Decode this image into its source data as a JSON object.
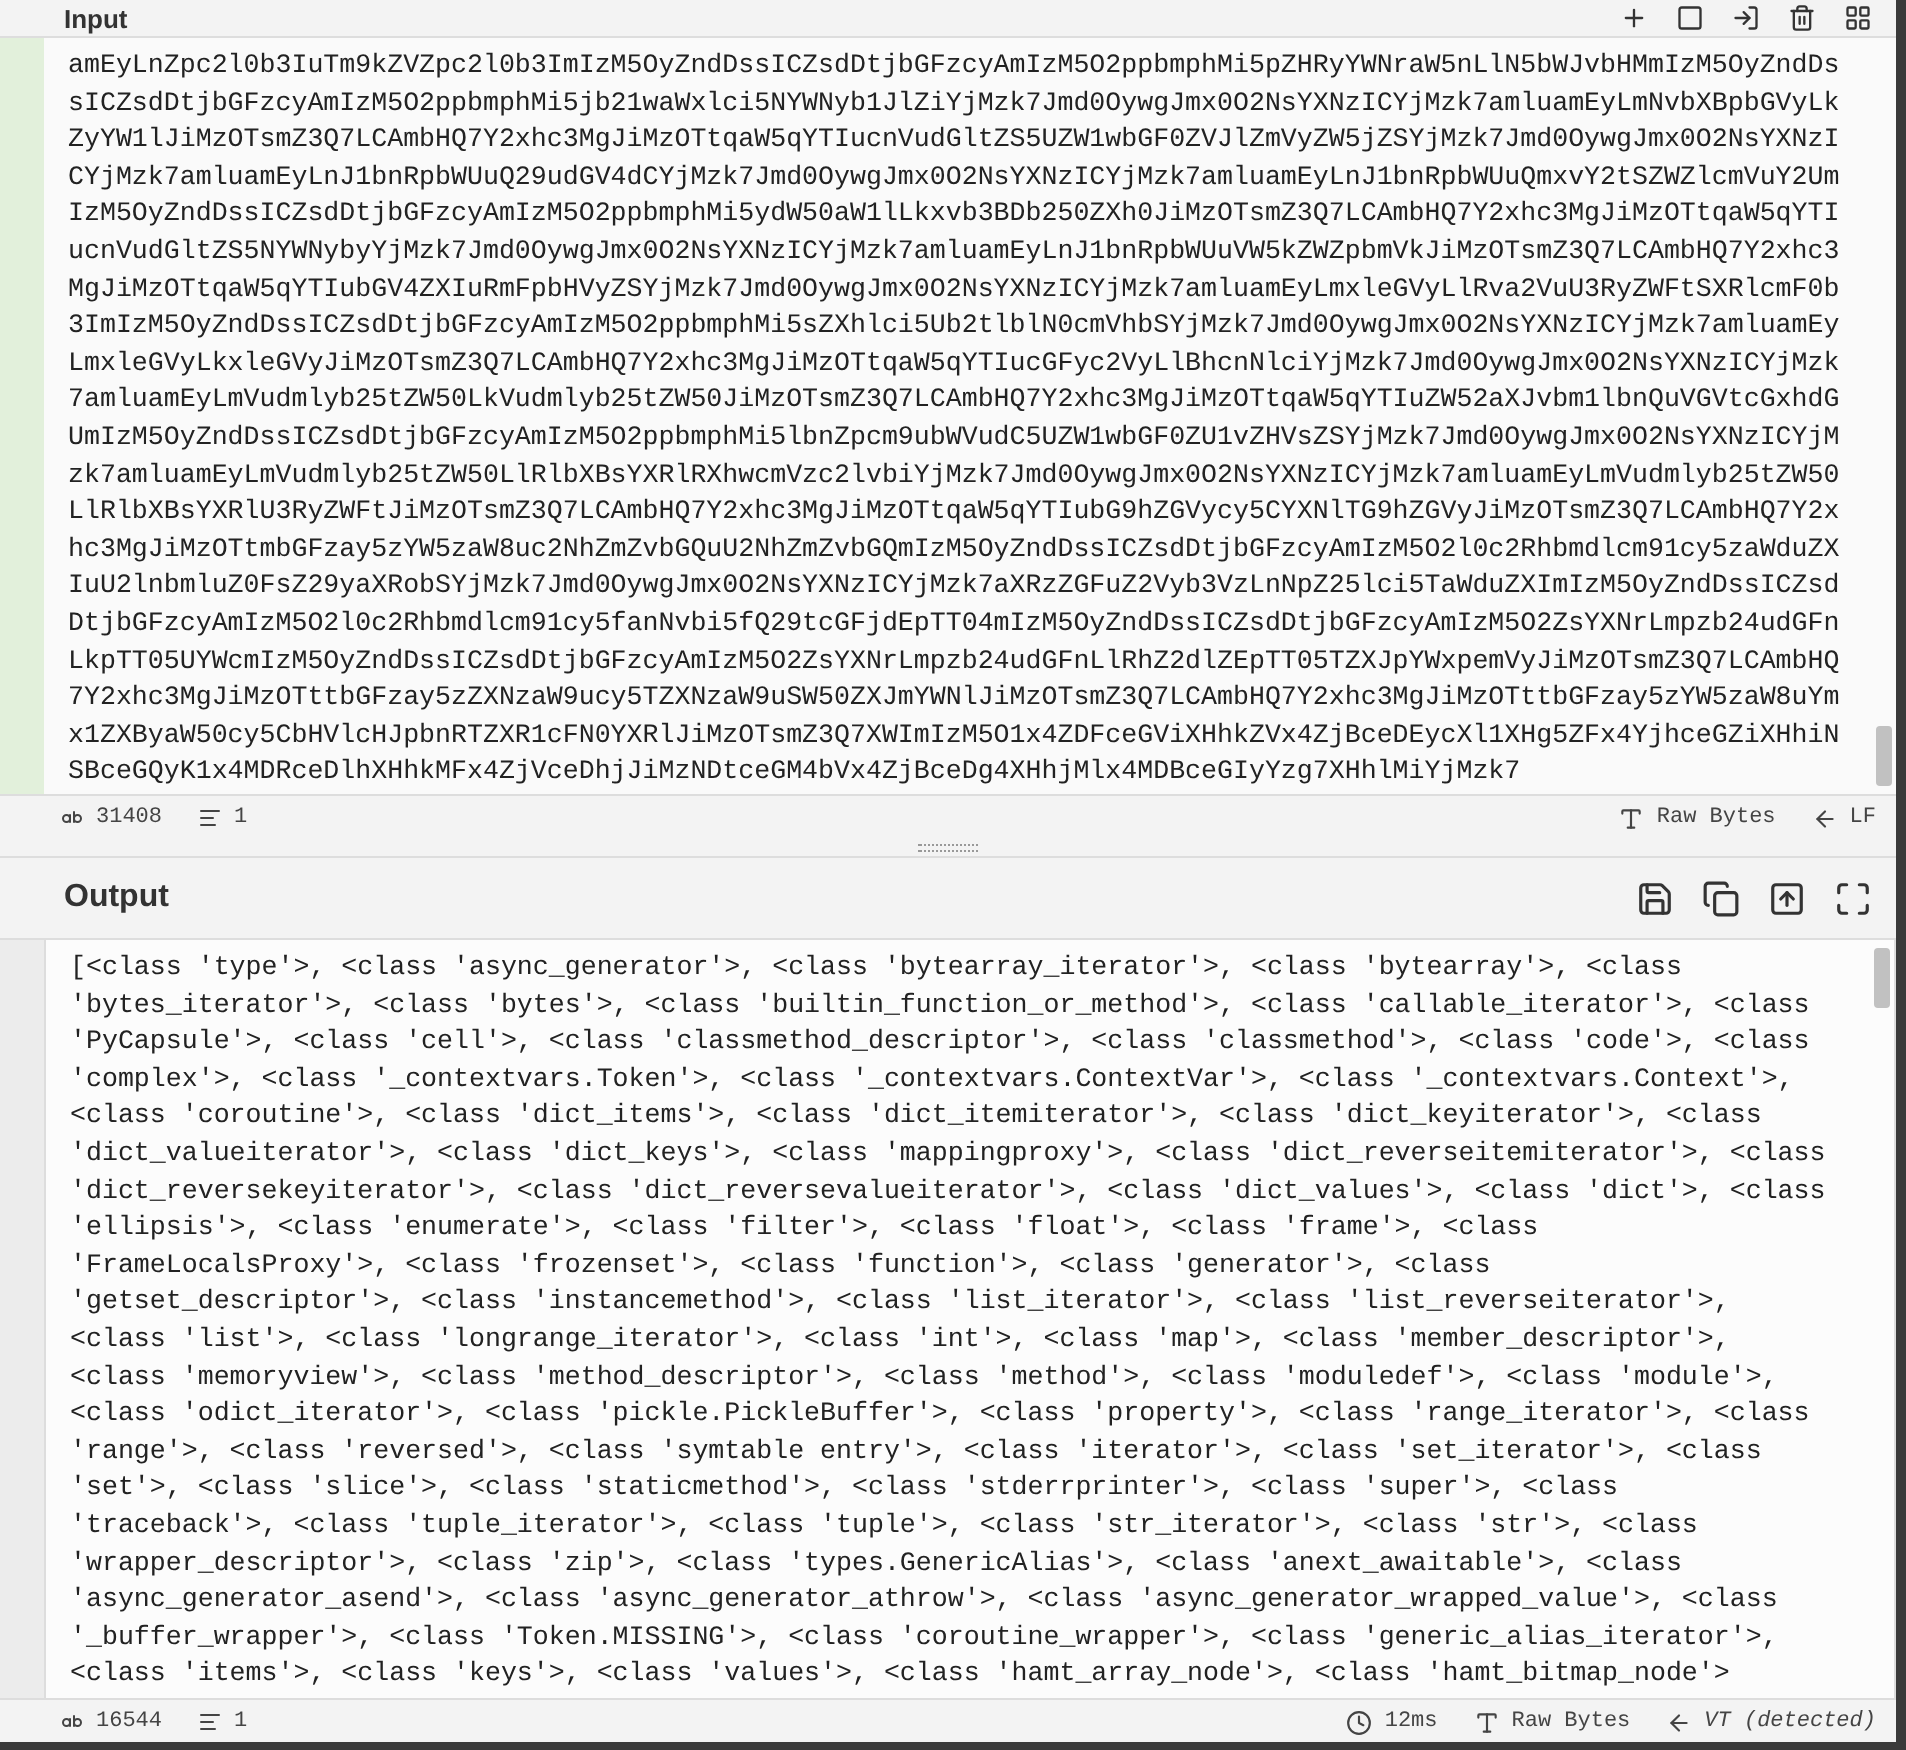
{
  "input": {
    "title": "Input",
    "lines": [
      "amEyLnZpc2l0b3IuTm9kZVZpc2l0b3ImIzM5OyZndDssICZsdDtjbGFzcyAmIzM5O2ppbmphMi5pZHRyYWNraW5nLlN5bWJvbHMmIzM5OyZndDs",
      "sICZsdDtjbGFzcyAmIzM5O2ppbmphMi5jb21waWxlci5NYWNyb1JlZiYjMzk7Jmd0OywgJmx0O2NsYXNzICYjMzk7amluamEyLmNvbXBpbGVyLk",
      "ZyYW1lJiMzOTsmZ3Q7LCAmbHQ7Y2xhc3MgJiMzOTtqaW5qYTIucnVudGltZS5UZW1wbGF0ZVJlZmVyZW5jZSYjMzk7Jmd0OywgJmx0O2NsYXNzI",
      "CYjMzk7amluamEyLnJ1bnRpbWUuQ29udGV4dCYjMzk7Jmd0OywgJmx0O2NsYXNzICYjMzk7amluamEyLnJ1bnRpbWUuQmxvY2tSZWZlcmVuY2Um",
      "IzM5OyZndDssICZsdDtjbGFzcyAmIzM5O2ppbmphMi5ydW50aW1lLkxvb3BDb250ZXh0JiMzOTsmZ3Q7LCAmbHQ7Y2xhc3MgJiMzOTtqaW5qYTI",
      "ucnVudGltZS5NYWNybyYjMzk7Jmd0OywgJmx0O2NsYXNzICYjMzk7amluamEyLnJ1bnRpbWUuVW5kZWZpbmVkJiMzOTsmZ3Q7LCAmbHQ7Y2xhc3",
      "MgJiMzOTtqaW5qYTIubGV4ZXIuRmFpbHVyZSYjMzk7Jmd0OywgJmx0O2NsYXNzICYjMzk7amluamEyLmxleGVyLlRva2VuU3RyZWFtSXRlcmF0b",
      "3ImIzM5OyZndDssICZsdDtjbGFzcyAmIzM5O2ppbmphMi5sZXhlci5Ub2tlblN0cmVhbSYjMzk7Jmd0OywgJmx0O2NsYXNzICYjMzk7amluamEy",
      "LmxleGVyLkxleGVyJiMzOTsmZ3Q7LCAmbHQ7Y2xhc3MgJiMzOTtqaW5qYTIucGFyc2VyLlBhcnNlciYjMzk7Jmd0OywgJmx0O2NsYXNzICYjMzk",
      "7amluamEyLmVudmlyb25tZW50LkVudmlyb25tZW50JiMzOTsmZ3Q7LCAmbHQ7Y2xhc3MgJiMzOTtqaW5qYTIuZW52aXJvbm1lbnQuVGVtcGxhdG",
      "UmIzM5OyZndDssICZsdDtjbGFzcyAmIzM5O2ppbmphMi5lbnZpcm9ubWVudC5UZW1wbGF0ZU1vZHVsZSYjMzk7Jmd0OywgJmx0O2NsYXNzICYjM",
      "zk7amluamEyLmVudmlyb25tZW50LlRlbXBsYXRlRXhwcmVzc2lvbiYjMzk7Jmd0OywgJmx0O2NsYXNzICYjMzk7amluamEyLmVudmlyb25tZW50",
      "LlRlbXBsYXRlU3RyZWFtJiMzOTsmZ3Q7LCAmbHQ7Y2xhc3MgJiMzOTtqaW5qYTIubG9hZGVycy5CYXNlTG9hZGVyJiMzOTsmZ3Q7LCAmbHQ7Y2x",
      "hc3MgJiMzOTtmbGFzay5zYW5zaW8uc2NhZmZvbGQuU2NhZmZvbGQmIzM5OyZndDssICZsdDtjbGFzcyAmIzM5O2l0c2Rhbmdlcm91cy5zaWduZX",
      "IuU2lnbmluZ0FsZ29yaXRobSYjMzk7Jmd0OywgJmx0O2NsYXNzICYjMzk7aXRzZGFuZ2Vyb3VzLnNpZ25lci5TaWduZXImIzM5OyZndDssICZsd",
      "DtjbGFzcyAmIzM5O2l0c2Rhbmdlcm91cy5fanNvbi5fQ29tcGFjdEpTT04mIzM5OyZndDssICZsdDtjbGFzcyAmIzM5O2ZsYXNrLmpzb24udGFn",
      "LkpTT05UYWcmIzM5OyZndDssICZsdDtjbGFzcyAmIzM5O2ZsYXNrLmpzb24udGFnLlRhZ2dlZEpTT05TZXJpYWxpemVyJiMzOTsmZ3Q7LCAmbHQ",
      "7Y2xhc3MgJiMzOTttbGFzay5zZXNzaW9ucy5TZXNzaW9uSW50ZXJmYWNlJiMzOTsmZ3Q7LCAmbHQ7Y2xhc3MgJiMzOTttbGFzay5zYW5zaW8uYm",
      "x1ZXByaW50cy5CbHVlcHJpbnRTZXR1cFN0YXRlJiMzOTsmZ3Q7XWImIzM5O1x4ZDFceGViXHhkZVx4ZjBceDEycXl1XHg5ZFx4YjhceGZiXHhiN",
      "SBceGQyK1x4MDRceDlhXHhkMFx4ZjVceDhjJiMzNDtceGM4bVx4ZjBceDg4XHhjMlx4MDBceGIyYzg7XHhlMiYjMzk7"
    ],
    "status": {
      "length": "31408",
      "lines": "1",
      "format": "Raw Bytes",
      "eol": "LF"
    }
  },
  "output": {
    "title": "Output",
    "lines": [
      "[<class 'type'>, <class 'async_generator'>, <class 'bytearray_iterator'>, <class 'bytearray'>, <class",
      "'bytes_iterator'>, <class 'bytes'>, <class 'builtin_function_or_method'>, <class 'callable_iterator'>, <class",
      "'PyCapsule'>, <class 'cell'>, <class 'classmethod_descriptor'>, <class 'classmethod'>, <class 'code'>, <class",
      "'complex'>, <class '_contextvars.Token'>, <class '_contextvars.ContextVar'>, <class '_contextvars.Context'>,",
      "<class 'coroutine'>, <class 'dict_items'>, <class 'dict_itemiterator'>, <class 'dict_keyiterator'>, <class",
      "'dict_valueiterator'>, <class 'dict_keys'>, <class 'mappingproxy'>, <class 'dict_reverseitemiterator'>, <class",
      "'dict_reversekeyiterator'>, <class 'dict_reversevalueiterator'>, <class 'dict_values'>, <class 'dict'>, <class",
      "'ellipsis'>, <class 'enumerate'>, <class 'filter'>, <class 'float'>, <class 'frame'>, <class",
      "'FrameLocalsProxy'>, <class 'frozenset'>, <class 'function'>, <class 'generator'>, <class",
      "'getset_descriptor'>, <class 'instancemethod'>, <class 'list_iterator'>, <class 'list_reverseiterator'>,",
      "<class 'list'>, <class 'longrange_iterator'>, <class 'int'>, <class 'map'>, <class 'member_descriptor'>,",
      "<class 'memoryview'>, <class 'method_descriptor'>, <class 'method'>, <class 'moduledef'>, <class 'module'>,",
      "<class 'odict_iterator'>, <class 'pickle.PickleBuffer'>, <class 'property'>, <class 'range_iterator'>, <class",
      "'range'>, <class 'reversed'>, <class 'symtable entry'>, <class 'iterator'>, <class 'set_iterator'>, <class",
      "'set'>, <class 'slice'>, <class 'staticmethod'>, <class 'stderrprinter'>, <class 'super'>, <class",
      "'traceback'>, <class 'tuple_iterator'>, <class 'tuple'>, <class 'str_iterator'>, <class 'str'>, <class",
      "'wrapper_descriptor'>, <class 'zip'>, <class 'types.GenericAlias'>, <class 'anext_awaitable'>, <class",
      "'async_generator_asend'>, <class 'async_generator_athrow'>, <class 'async_generator_wrapped_value'>, <class",
      "'_buffer_wrapper'>, <class 'Token.MISSING'>, <class 'coroutine_wrapper'>, <class 'generic_alias_iterator'>,",
      "<class 'items'>, <class 'keys'>, <class 'values'>, <class 'hamt_array_node'>, <class 'hamt_bitmap_node'>"
    ],
    "status": {
      "length": "16544",
      "lines": "1",
      "time": "12ms",
      "format": "Raw Bytes",
      "eol": "VT (detected)"
    }
  }
}
